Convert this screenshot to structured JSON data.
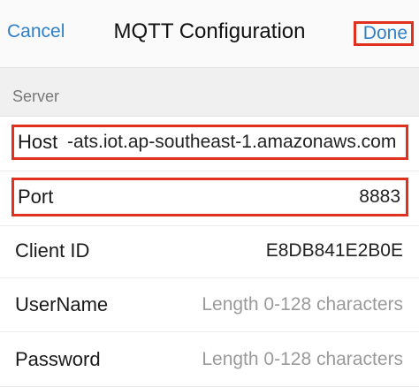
{
  "navbar": {
    "cancel_label": "Cancel",
    "title": "MQTT Configuration",
    "done_label": "Done"
  },
  "section": {
    "server_header": "Server"
  },
  "fields": {
    "host": {
      "label": "Host",
      "value": "-ats.iot.ap-southeast-1.amazonaws.com"
    },
    "port": {
      "label": "Port",
      "value": "8883"
    },
    "client_id": {
      "label": "Client ID",
      "value": "E8DB841E2B0E"
    },
    "username": {
      "label": "UserName",
      "placeholder": "Length 0-128 characters"
    },
    "password": {
      "label": "Password",
      "placeholder": "Length 0-128 characters"
    }
  },
  "colors": {
    "accent": "#2f80c9",
    "highlight": "#e0301e"
  }
}
